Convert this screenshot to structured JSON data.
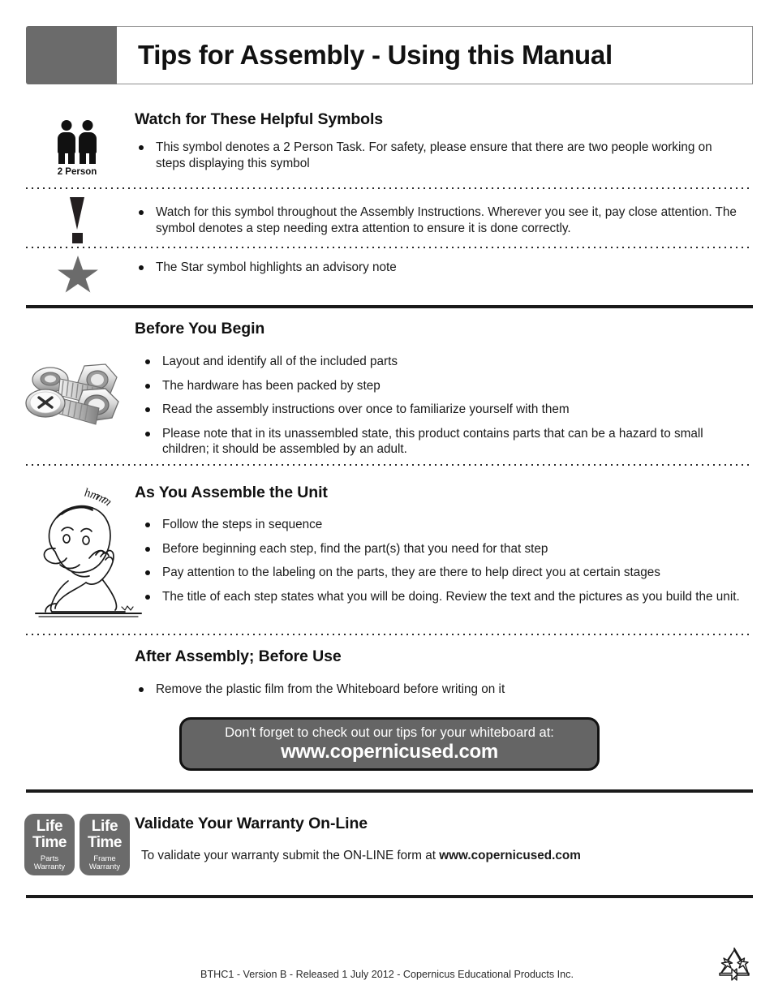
{
  "header": {
    "title": "Tips for Assembly - Using this Manual"
  },
  "symbols_section": {
    "heading": "Watch for These Helpful Symbols",
    "rows": [
      {
        "icon": "two-person-icon",
        "icon_caption": "2 Person",
        "text": "This symbol denotes a 2 Person Task.  For safety, please ensure that there are two people working on steps displaying this symbol"
      },
      {
        "icon": "exclamation-icon",
        "icon_caption": "",
        "text": "Watch for this symbol throughout the Assembly Instructions.  Wherever you see it, pay close attention.  The symbol denotes a step needing extra attention to ensure it is done correctly."
      },
      {
        "icon": "star-icon",
        "icon_caption": "",
        "text": "The Star symbol highlights an advisory note"
      }
    ]
  },
  "before_you_begin": {
    "heading": "Before You Begin",
    "icon": "screws-and-nuts-icon",
    "bullets": [
      "Layout and identify all of the included parts",
      "The hardware has been packed by step",
      "Read the assembly instructions over once to familiarize yourself with them",
      "Please note that in its unassembled state, this product contains parts that can be a hazard to small children; it should be assembled by an adult."
    ]
  },
  "as_you_assemble": {
    "heading": "As You Assemble the Unit",
    "icon": "thinking-person-cartoon-icon",
    "icon_text": "hmmm",
    "bullets": [
      "Follow the steps in sequence",
      "Before beginning each step, find the part(s) that you need for that step",
      "Pay attention to the labeling on the parts, they are there to help direct you at certain stages",
      "The title of each step states what you will be doing.  Review the text and the pictures as you build the unit."
    ]
  },
  "after_assembly": {
    "heading": "After Assembly; Before Use",
    "bullets": [
      "Remove the plastic film from the Whiteboard before writing on it"
    ],
    "callout": {
      "line1": "Don't forget to check out our tips for your whiteboard at:",
      "line2": "www.copernicused.com"
    }
  },
  "warranty": {
    "heading": "Validate Your Warranty On-Line",
    "badges": [
      {
        "life": "Life",
        "time": "Time",
        "sub1": "Parts",
        "sub2": "Warranty"
      },
      {
        "life": "Life",
        "time": "Time",
        "sub1": "Frame",
        "sub2": "Warranty"
      }
    ],
    "text_prefix": "To validate your warranty submit the ON-LINE form at ",
    "url": "www.copernicused.com"
  },
  "footer": {
    "text": "BTHC1 - Version B - Released 1 July 2012 - Copernicus Educational Products Inc.",
    "recycle_icon": "recycle-icon"
  },
  "colors": {
    "header_block": "#6b6b6b",
    "callout_bg": "#656565",
    "badge_bg": "#6b6b6b",
    "star": "#6b6b6b",
    "rule": "#1a1a1a"
  }
}
